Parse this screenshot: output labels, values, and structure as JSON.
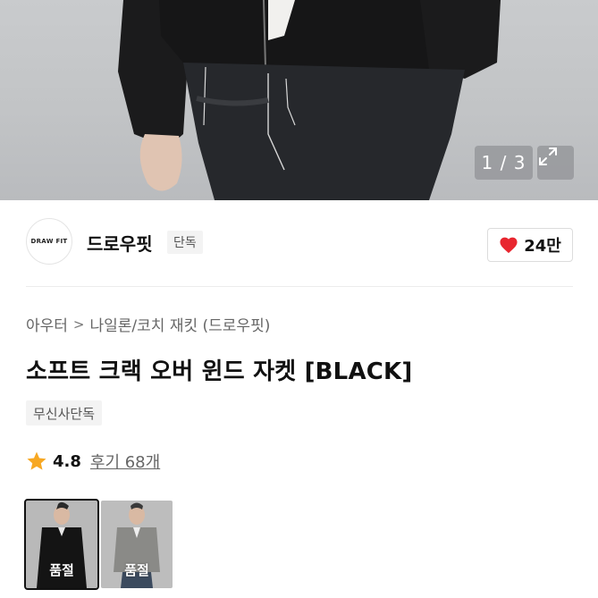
{
  "gallery": {
    "counter": "1 / 3"
  },
  "brand": {
    "logo_text": "DRAW FIT",
    "name": "드로우핏",
    "tag": "단독"
  },
  "like": {
    "count": "24만"
  },
  "breadcrumb": {
    "category": "아우터",
    "subcategory": "나일론/코치 재킷 (드로우핏)"
  },
  "product": {
    "title": "소프트 크랙 오버 윈드 자켓 [BLACK]",
    "badge": "무신사단독"
  },
  "rating": {
    "score": "4.8",
    "reviews": "후기 68개"
  },
  "colors": [
    {
      "soldout_label": "품절"
    },
    {
      "soldout_label": "품절"
    }
  ],
  "theme": {
    "heart": "#e8262f",
    "star": "#f7a823"
  }
}
